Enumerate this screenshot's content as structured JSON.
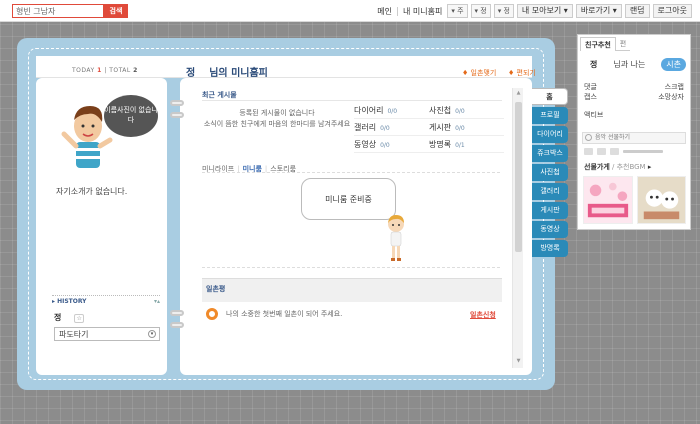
{
  "topbar": {
    "search_value": "형빈 그남자",
    "search_button": "검색",
    "links": [
      "메인",
      "내 미니홈피"
    ],
    "dropdowns": [
      "▾ 주",
      "▾ 정",
      "▾ 정"
    ],
    "buttons": [
      "내 모아보기 ▾",
      "바로가기 ▾",
      "랜덤",
      "로그아웃"
    ]
  },
  "counter": {
    "today_label": "TODAY",
    "today_value": "1",
    "total_label": "TOTAL",
    "total_value": "2"
  },
  "home": {
    "owner": "정",
    "title": "님의 미니홈피",
    "ilchon_link": "♦ 일촌맺기",
    "pyeon_link": "♦ 편되기"
  },
  "left": {
    "speech": "이름사진이 없습니다",
    "intro": "자기소개가 없습니다.",
    "history_label": "▸ HISTORY",
    "history_toggle": "▾▴",
    "owner_short": "정",
    "owner_tag": "☆",
    "pado_label": "파도타기",
    "pado_arrow": "▾"
  },
  "recent": {
    "label": "최근 게시물",
    "empty_msg": "등록된 게시물이 없습니다\n소식이 뜸한 친구에게 마음의 한마디를 남겨주세요",
    "stats": [
      [
        {
          "name": "다이어리",
          "count": "0/0"
        },
        {
          "name": "사진첩",
          "count": "0/0"
        }
      ],
      [
        {
          "name": "갤러리",
          "count": "0/0"
        },
        {
          "name": "게시판",
          "count": "0/0"
        }
      ],
      [
        {
          "name": "동영상",
          "count": "0/0"
        },
        {
          "name": "방명록",
          "count": "0/1"
        }
      ]
    ]
  },
  "subtabs": {
    "items": [
      "미니라이프",
      "미니룸",
      "스토리룸"
    ],
    "active": "미니룸"
  },
  "miniroom": {
    "bubble": "미니룸 준비중"
  },
  "ilchon": {
    "label": "일촌평",
    "msg": "나의 소중한 첫번째 일촌이 되어 주세요.",
    "apply": "일촌신청"
  },
  "side_tabs": [
    "홈",
    "프로필",
    "다이어리",
    "쥬크박스",
    "사진첩",
    "갤러리",
    "게시판",
    "동영상",
    "방명록"
  ],
  "rpanel": {
    "tabs": [
      "친구추천",
      "편"
    ],
    "me": "정",
    "with_label": "님과 나는",
    "relation": "시촌",
    "grid": [
      [
        "댓글",
        "스크랩"
      ],
      [
        "캡스",
        "소망상자"
      ]
    ],
    "activity": "액티브",
    "music": "음악 선물하기",
    "gift_title": "선물가게",
    "gift_sub": " / 추천BGM",
    "gift_more": "▸"
  },
  "colors": {
    "accent_red": "#e04a3a",
    "frame_blue": "#a9cde2",
    "tab_blue": "#2a8ab8",
    "link_orange": "#e46a1a"
  }
}
